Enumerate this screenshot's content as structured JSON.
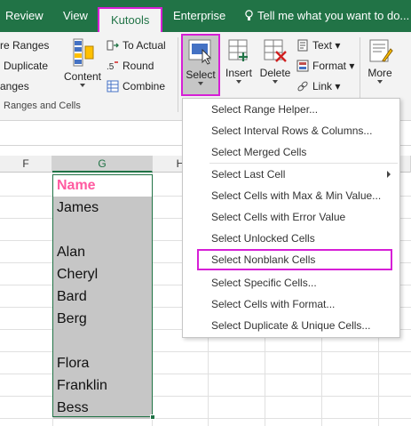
{
  "tabs": {
    "review": "Review",
    "view": "View",
    "kutools": "Kutools",
    "enterprise": "Enterprise"
  },
  "tell_me": "Tell me what you want to do...",
  "ribbon": {
    "left": {
      "compare_ranges": "re Ranges",
      "duplicate": "Duplicate",
      "ranges": "anges"
    },
    "content_label": "Content",
    "to_actual": "To Actual",
    "round": "Round",
    "combine": "Combine",
    "group_label": "Ranges and Cells",
    "select_label": "Select",
    "insert_label": "Insert",
    "delete_label": "Delete",
    "text_label": "Text",
    "format_label": "Format",
    "link_label": "Link",
    "more_label": "More"
  },
  "columns": {
    "f": "F",
    "g": "G",
    "h": "H",
    "l": "L"
  },
  "cells": {
    "header": "Name",
    "rows": [
      "James",
      "",
      "Alan",
      "Cheryl",
      "Bard",
      "Berg",
      "",
      "Flora",
      "Franklin",
      "Bess"
    ]
  },
  "menu": {
    "items": [
      "Select Range Helper...",
      "Select Interval Rows & Columns...",
      "Select Merged Cells",
      "Select Last Cell",
      "Select Cells with Max & Min Value...",
      "Select Cells with Error Value",
      "Select Unlocked Cells",
      "Select Nonblank Cells",
      "Select Specific Cells...",
      "Select Cells with Format...",
      "Select Duplicate & Unique Cells..."
    ]
  },
  "colors": {
    "ribbon_green": "#217346",
    "highlight_magenta": "#d61fd6",
    "header_pink": "#ff5aa0",
    "cell_gray": "#c6c6c6"
  }
}
